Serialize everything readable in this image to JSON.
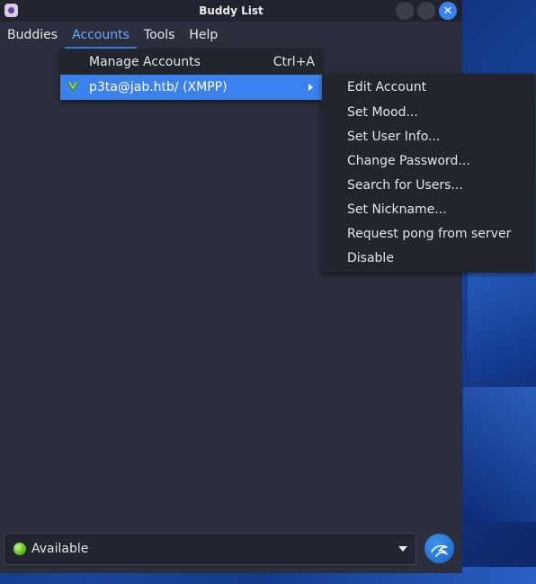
{
  "window": {
    "title": "Buddy List"
  },
  "menubar": {
    "items": [
      "Buddies",
      "Accounts",
      "Tools",
      "Help"
    ],
    "active": "Accounts"
  },
  "accounts_menu": {
    "manage_label": "Manage Accounts",
    "manage_accel": "Ctrl+A",
    "account_label": "p3ta@jab.htb/ (XMPP)"
  },
  "account_submenu": {
    "items": [
      "Edit Account",
      "Set Mood...",
      "Set User Info...",
      "Change Password...",
      "Search for Users...",
      "Set Nickname...",
      "Request pong from server",
      "Disable"
    ]
  },
  "status": {
    "label": "Available"
  },
  "colors": {
    "accent": "#3b82f0",
    "window_bg": "#2b2e3c",
    "menu_bg": "#22252e",
    "status_available": "#5cbf1d"
  },
  "icons": {
    "app": "pidgin-icon",
    "account": "xmpp-v-icon",
    "status": "available-dot-icon",
    "kali": "kali-dragon-icon"
  }
}
